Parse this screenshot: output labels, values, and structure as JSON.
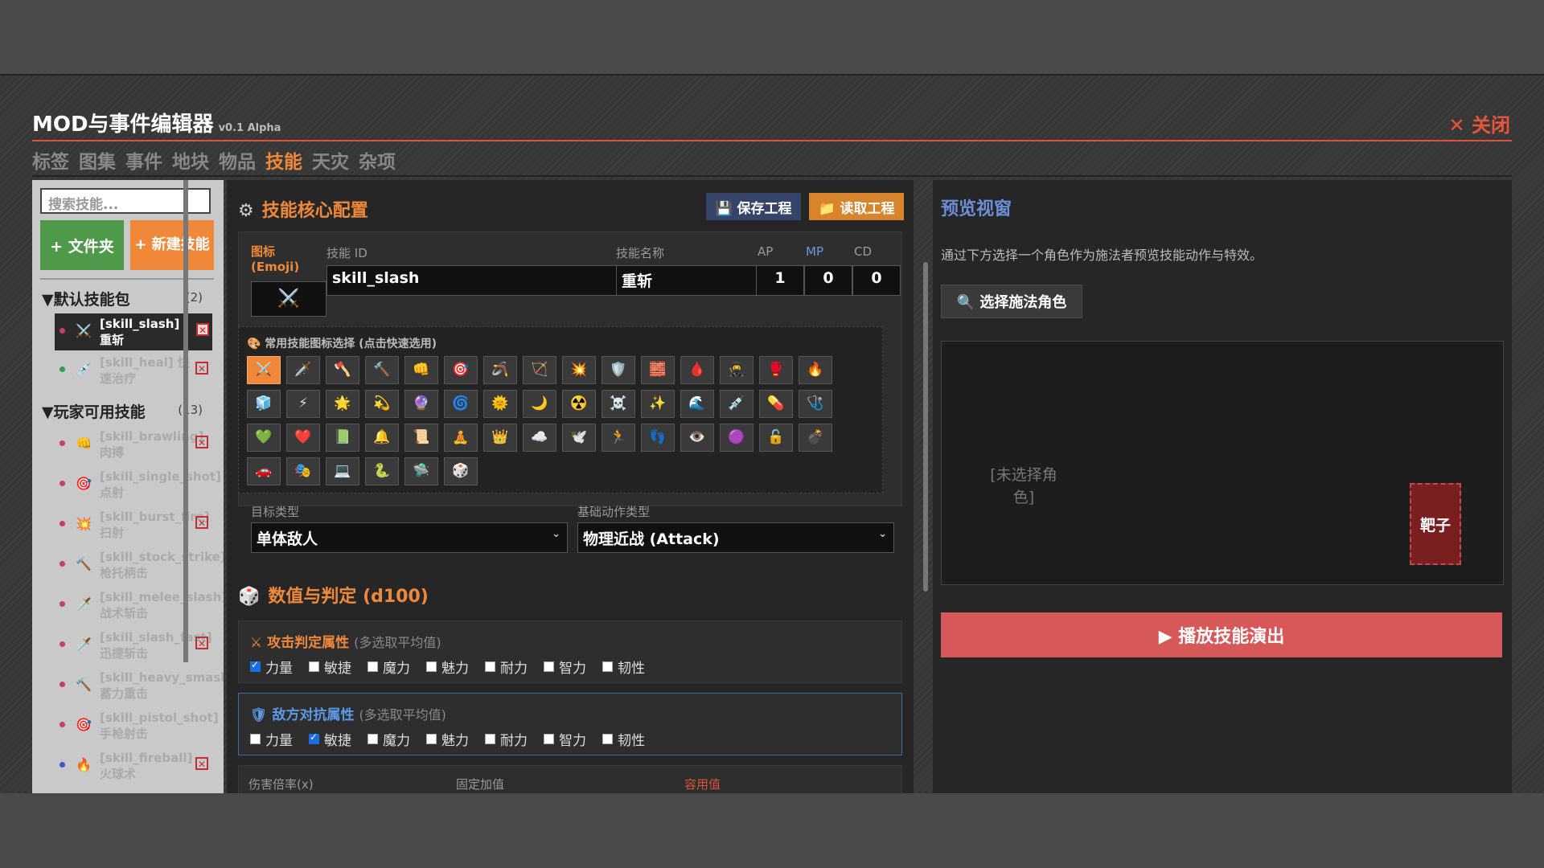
{
  "header": {
    "title": "MOD与事件编辑器",
    "version": "v0.1 Alpha",
    "close_label": "✕ 关闭"
  },
  "tabs": [
    {
      "label": "标签"
    },
    {
      "label": "图集"
    },
    {
      "label": "事件"
    },
    {
      "label": "地块"
    },
    {
      "label": "物品"
    },
    {
      "label": "技能"
    },
    {
      "label": "天灾"
    },
    {
      "label": "杂项"
    }
  ],
  "active_tab": "技能",
  "sidebar": {
    "search_placeholder": "搜索技能...",
    "add_folder_label": "+ 文件夹",
    "new_skill_label": "+ 新建技能",
    "folders": [
      {
        "name": "▼默认技能包",
        "count": "(2)"
      },
      {
        "name": "▼玩家可用技能",
        "count": "(13)"
      }
    ],
    "default_skills": [
      {
        "id": "[skill_slash]",
        "name": "重斩",
        "emoji": "⚔️",
        "selected": true
      },
      {
        "id": "[skill_heal] 快",
        "name": "速治疗",
        "emoji": "💉",
        "selected": false
      }
    ],
    "player_skills": [
      {
        "id": "[skill_brawling]",
        "name": "肉搏",
        "emoji": "👊"
      },
      {
        "id": "[skill_single_shot]",
        "name": "点射",
        "emoji": "🎯"
      },
      {
        "id": "[skill_burst_fire]",
        "name": "扫射",
        "emoji": "💥"
      },
      {
        "id": "[skill_stock_strike]",
        "name": "枪托柄击",
        "emoji": "🔨"
      },
      {
        "id": "[skill_melee_slash]",
        "name": "战术斩击",
        "emoji": "🗡️"
      },
      {
        "id": "[skill_slash_fast]",
        "name": "迅捷斩击",
        "emoji": "🗡️"
      },
      {
        "id": "[skill_heavy_smash]",
        "name": "蓄力重击",
        "emoji": "🔨"
      },
      {
        "id": "[skill_pistol_shot]",
        "name": "手枪射击",
        "emoji": "🎯"
      },
      {
        "id": "[skill_fireball]",
        "name": "火球术",
        "emoji": "🔥"
      }
    ],
    "remove_icon": "✕"
  },
  "core": {
    "title": "技能核心配置",
    "save_label": "💾 保存工程",
    "load_label": "📁 读取工程",
    "icon_label": "图标 (Emoji)",
    "icon_value": "⚔️",
    "id_label": "技能 ID",
    "id_value": "skill_slash",
    "name_label": "技能名称",
    "name_value": "重斩",
    "ap_label": "AP",
    "ap_value": "1",
    "mp_label": "MP",
    "mp_value": "0",
    "cd_label": "CD",
    "cd_value": "0",
    "icon_picker_title": "🎨 常用技能图标选择 (点击快速选用)",
    "icons": [
      "⚔️",
      "🗡️",
      "🪓",
      "🔨",
      "👊",
      "🎯",
      "🪃",
      "🏹",
      "💥",
      "🛡️",
      "🧱",
      "🩸",
      "🥷",
      "🥊",
      "🔥",
      "🧊",
      "⚡",
      "🌟",
      "💫",
      "🔮",
      "🌀",
      "🌞",
      "🌙",
      "☢️",
      "☠️",
      "✨",
      "🌊",
      "💉",
      "💊",
      "🩺",
      "💚",
      "❤️",
      "📗",
      "🔔",
      "📜",
      "🧘",
      "👑",
      "☁️",
      "🕊️",
      "🏃",
      "👣",
      "👁️",
      "🟣",
      "🔓",
      "💣",
      "🚗",
      "🎭",
      "💻",
      "🐍",
      "🛸",
      "🎲"
    ],
    "target_label": "目标类型",
    "target_value": "单体敌人",
    "action_label": "基础动作类型",
    "action_value": "物理近战 (Attack)"
  },
  "dice": {
    "title": "数值与判定 (d100)",
    "attack_title": "攻击判定属性",
    "attack_hint": "(多选取平均值)",
    "defense_title": "敌方对抗属性",
    "defense_hint": "(多选取平均值)",
    "attrs": [
      "力量",
      "敏捷",
      "魔力",
      "魅力",
      "耐力",
      "智力",
      "韧性"
    ],
    "attack_checked": [
      "力量"
    ],
    "defense_checked": [
      "敏捷"
    ],
    "damage_label": "伤害倍率(x)",
    "fixed_label": "固定加值",
    "fixed2_label": "容用值"
  },
  "preview": {
    "title": "预览视窗",
    "desc": "通过下方选择一个角色作为施法者预览技能动作与特效。",
    "select_caster_label": "🔍 选择施法角色",
    "no_caster": "[未选择角色]",
    "target_label": "靶子",
    "play_label": "▶ 播放技能演出"
  }
}
